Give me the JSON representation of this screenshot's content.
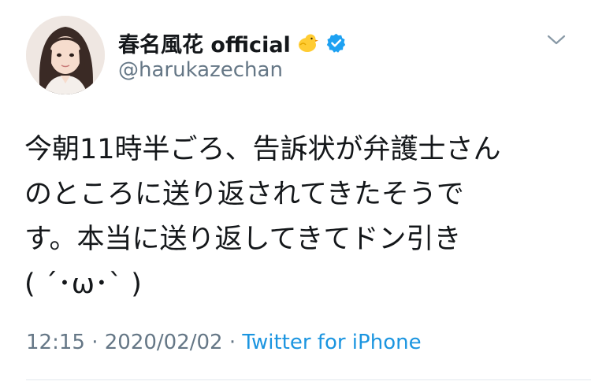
{
  "user": {
    "display_name": "春名風花 official",
    "handle": "@harukazechan",
    "verified": true,
    "name_emoji": "chick-icon"
  },
  "tweet": {
    "lines": [
      "今朝11時半ごろ、告訴状が弁護士さん",
      "のところに送り返されてきたそうで",
      "す。本当に送り返してきてドン引き",
      "( ´･ω･` )"
    ]
  },
  "meta": {
    "time": "12:15",
    "separator": "·",
    "date": "2020/02/02",
    "source": "Twitter for iPhone"
  },
  "colors": {
    "text": "#14171a",
    "secondary": "#657786",
    "link": "#1b95e0",
    "verified": "#1da1f2",
    "divider": "#e1e8ed"
  },
  "icons": {
    "menu": "chevron-down-icon",
    "verified": "verified-badge-icon"
  }
}
